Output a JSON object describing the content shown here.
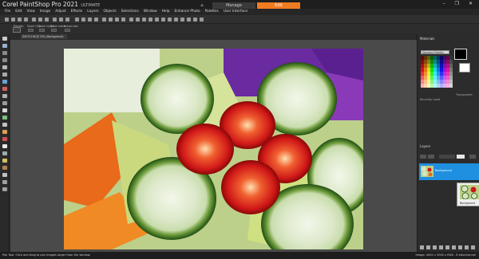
{
  "app": {
    "title_brand": "Corel",
    "title_product": "PaintShop Pro 2021",
    "title_edition": "ULTIMATE"
  },
  "workspace_tabs": {
    "manage": "Manage",
    "edit": "Edit"
  },
  "window_controls": "–  ❐  ✕",
  "menu": [
    "File",
    "Edit",
    "View",
    "Image",
    "Adjust",
    "Effects",
    "Layers",
    "Objects",
    "Selections",
    "Window",
    "Help",
    "Enhance Photo",
    "Palettes",
    "User Interface"
  ],
  "tool_options": {
    "presets_label": "Presets:",
    "zoom_label": "Zoom (%):",
    "zoom_in_out_label": "Zoom in/out:",
    "zoom_more_label": "Zoom more:",
    "actual_size_label": "Actual size:"
  },
  "document_tab": {
    "label": "DSCF1198 @ 33% (Background)"
  },
  "materials": {
    "heading": "Materials",
    "palette_select": "Standard Palette",
    "transparent_label": "Transparent",
    "recently_used_label": "Recently Used"
  },
  "layers": {
    "heading": "Layers",
    "layer_name": "Background",
    "popup_name": "Background"
  },
  "status": {
    "left": "Pan Tool: Click and drag to pan images larger than the window.",
    "right": "Image: 4000 x 3000 x RGB - 8 bits/channel"
  },
  "colors": {
    "accent": "#f07c22",
    "layer_selected": "#1f8fe0",
    "foreground": "#000000",
    "background": "#ffffff"
  }
}
